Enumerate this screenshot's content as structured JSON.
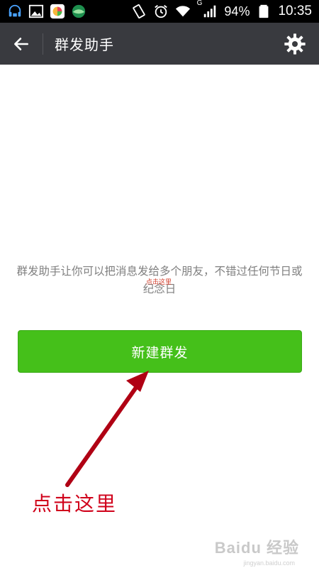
{
  "status_bar": {
    "battery": "94%",
    "time": "10:35",
    "network_type": "G",
    "icons": [
      "headset-icon",
      "image-icon",
      "app-icon",
      "browser-icon",
      "vibrate-icon",
      "alarm-icon",
      "wifi-icon",
      "signal-icon",
      "battery-icon"
    ]
  },
  "app_bar": {
    "title": "群发助手",
    "back_icon": "arrow-left-icon",
    "settings_icon": "gear-icon"
  },
  "main": {
    "description": "群发助手让你可以把消息发给多个朋友，不错过任何节日或纪念日",
    "tiny_label": "点击这里",
    "button_label": "新建群发"
  },
  "annotation": {
    "label": "点击这里",
    "color": "#d0021b"
  },
  "watermark": {
    "text": "Baidu 经验",
    "sub": "jingyan.baidu.com"
  },
  "colors": {
    "app_bar": "#393a3f",
    "button": "#45c01a",
    "arrow": "#b00014"
  }
}
